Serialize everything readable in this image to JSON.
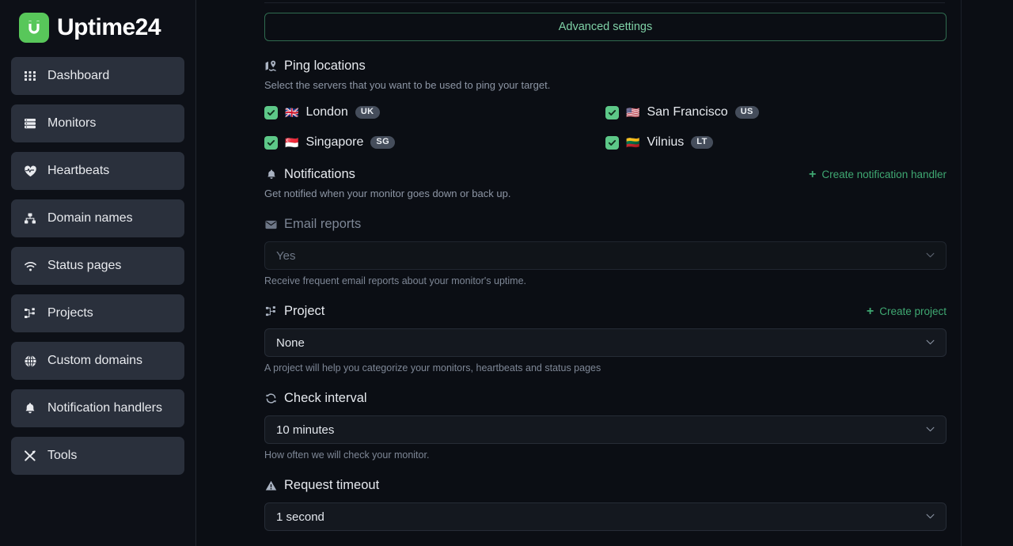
{
  "brand": {
    "name": "Uptime24",
    "logo_icon": "uptime-logo-icon",
    "accent": "#58c75a"
  },
  "sidebar": {
    "items": [
      {
        "label": "Dashboard",
        "icon": "grid-icon"
      },
      {
        "label": "Monitors",
        "icon": "server-icon"
      },
      {
        "label": "Heartbeats",
        "icon": "heart-pulse-icon"
      },
      {
        "label": "Domain names",
        "icon": "sitemap-icon"
      },
      {
        "label": "Status pages",
        "icon": "wifi-icon"
      },
      {
        "label": "Projects",
        "icon": "project-tree-icon"
      },
      {
        "label": "Custom domains",
        "icon": "globe-icon"
      },
      {
        "label": "Notification handlers",
        "icon": "bell-icon"
      },
      {
        "label": "Tools",
        "icon": "tools-icon"
      }
    ]
  },
  "main": {
    "advanced_settings": {
      "label": "Advanced settings",
      "border_color": "#2f6b4f",
      "text_color": "#7fd1a6"
    },
    "ping_locations": {
      "title": "Ping locations",
      "icon": "map-location-icon",
      "description": "Select the servers that you want to be used to ping your target.",
      "servers": [
        {
          "name": "London",
          "code": "UK",
          "flag": "🇬🇧",
          "checked": true
        },
        {
          "name": "San Francisco",
          "code": "US",
          "flag": "🇺🇸",
          "checked": true
        },
        {
          "name": "Singapore",
          "code": "SG",
          "flag": "🇸🇬",
          "checked": true
        },
        {
          "name": "Vilnius",
          "code": "LT",
          "flag": "🇱🇹",
          "checked": true
        }
      ]
    },
    "notifications": {
      "title": "Notifications",
      "icon": "bell-icon",
      "description": "Get notified when your monitor goes down or back up.",
      "create_link": "Create notification handler"
    },
    "email_reports": {
      "title": "Email reports",
      "icon": "envelope-icon",
      "value": "Yes",
      "hint": "Receive frequent email reports about your monitor's uptime.",
      "disabled": true
    },
    "project": {
      "title": "Project",
      "icon": "project-tree-icon",
      "create_link": "Create project",
      "value": "None",
      "hint": "A project will help you categorize your monitors, heartbeats and status pages"
    },
    "check_interval": {
      "title": "Check interval",
      "icon": "refresh-icon",
      "value": "10 minutes",
      "hint": "How often we will check your monitor."
    },
    "request_timeout": {
      "title": "Request timeout",
      "icon": "warning-triangle-icon",
      "value": "1 second"
    }
  }
}
